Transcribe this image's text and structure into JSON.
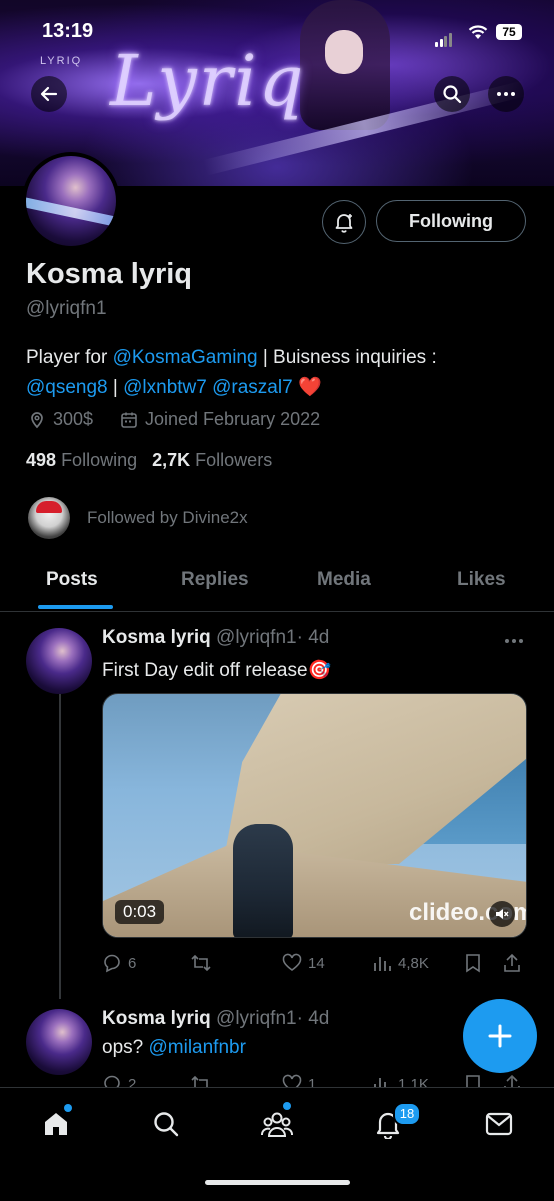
{
  "status_bar": {
    "time": "13:19",
    "battery": "75"
  },
  "banner": {
    "title": "Lyriq",
    "small_label": "LYRIQ"
  },
  "profile": {
    "follow_button": "Following",
    "name": "Kosma lyriq",
    "handle": "@lyriqfn1",
    "bio": {
      "part1": "Player for ",
      "link1": "@KosmaGaming",
      "part2": " | Buisness inquiries :",
      "link2": "@qseng8",
      "sep": " | ",
      "link3": "@lxnbtw7",
      "space": " ",
      "link4": "@raszal7",
      "emoji": "❤️"
    },
    "location": "300$",
    "joined": "Joined February 2022",
    "following_count": "498",
    "following_label": "Following",
    "followers_count": "2,7K",
    "followers_label": "Followers",
    "followed_by": "Followed by Divine2x"
  },
  "tabs": [
    "Posts",
    "Replies",
    "Media",
    "Likes"
  ],
  "posts": [
    {
      "name": "Kosma lyriq",
      "handle": "@lyriqfn1",
      "time": "· 4d",
      "text": "First Day edit off release🎯",
      "video_duration": "0:03",
      "video_watermark": "clideo.com",
      "replies": "6",
      "likes": "14",
      "views": "4,8K"
    },
    {
      "name": "Kosma lyriq",
      "handle": "@lyriqfn1",
      "time": "· 4d",
      "text_prefix": "ops? ",
      "text_link": "@milanfnbr",
      "replies": "2",
      "likes": "1",
      "views": "1,1K"
    }
  ],
  "nav": {
    "notifications_badge": "18"
  },
  "colors": {
    "accent": "#1d9bf0",
    "background": "#000000",
    "muted": "#71767b"
  }
}
